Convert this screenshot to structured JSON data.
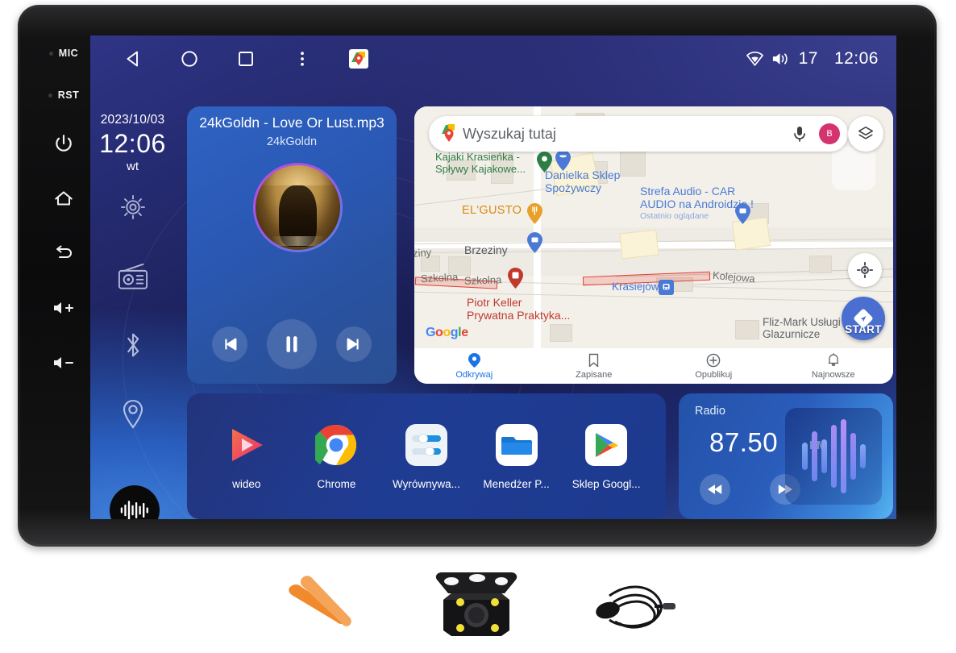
{
  "device": {
    "hardware_buttons": [
      {
        "name": "mic",
        "label": "MIC"
      },
      {
        "name": "rst",
        "label": "RST"
      },
      {
        "name": "power",
        "label": "power-icon"
      },
      {
        "name": "home",
        "label": "home-icon"
      },
      {
        "name": "back",
        "label": "back-icon"
      },
      {
        "name": "volume-up",
        "label": "vol-up-icon"
      },
      {
        "name": "volume-down",
        "label": "vol-down-icon"
      }
    ]
  },
  "statusbar": {
    "nav": [
      {
        "name": "back",
        "icon": "triangle-left-icon"
      },
      {
        "name": "home",
        "icon": "circle-icon"
      },
      {
        "name": "recents",
        "icon": "square-icon"
      },
      {
        "name": "more",
        "icon": "overflow-dots-icon"
      },
      {
        "name": "maps-shortcut",
        "icon": "google-maps-pin-icon"
      }
    ],
    "wifi_icon": "wifi-icon",
    "volume_icon": "speaker-icon",
    "volume_level": "17",
    "clock": "12:06"
  },
  "dock": {
    "date": "2023/10/03",
    "time": "12:06",
    "weekday": "wt",
    "items": [
      {
        "name": "settings",
        "icon": "gear-icon"
      },
      {
        "name": "radio",
        "icon": "radio-icon"
      },
      {
        "name": "bluetooth",
        "icon": "bluetooth-icon"
      },
      {
        "name": "navigation",
        "icon": "location-pin-icon"
      }
    ],
    "assistant": {
      "name": "voice-assistant",
      "icon": "waveform-icon"
    }
  },
  "music": {
    "title": "24kGoldn - Love Or Lust.mp3",
    "artist": "24kGoldn",
    "album_art_alt": "24kGoldn album cover",
    "controls": [
      {
        "name": "previous-track",
        "icon": "skip-previous-icon"
      },
      {
        "name": "play-pause",
        "icon": "pause-icon"
      },
      {
        "name": "next-track",
        "icon": "skip-next-icon"
      }
    ]
  },
  "maps": {
    "search_placeholder": "Wyszukaj tutaj",
    "mic_icon": "microphone-icon",
    "avatar_initial": "B",
    "layers_icon": "layers-icon",
    "locate_icon": "my-location-icon",
    "start_label": "START",
    "attribution": "Google",
    "pois": [
      {
        "name": "kajaki",
        "line1": "Kajaki Krasieńka -",
        "line2": "Spływy Kajakowe...",
        "color": "green"
      },
      {
        "name": "danielka",
        "line1": "Danielka Sklep",
        "line2": "Spożywczy",
        "color": "blue"
      },
      {
        "name": "strefa-audio",
        "line1": "Strefa Audio - CAR",
        "line2": "AUDIO na Androidzie !",
        "sub": "Ostatnio oglądane",
        "color": "blue"
      },
      {
        "name": "elgusto",
        "line1": "EL'GUSTO",
        "color": "orange"
      },
      {
        "name": "piotr-keller",
        "line1": "Piotr Keller",
        "line2": "Prywatna Praktyka...",
        "color": "red"
      },
      {
        "name": "fliz-mark",
        "line1": "Fliz-Mark Usługi",
        "line2": "Glazurnicze",
        "color": "grey"
      },
      {
        "name": "krasiejow-station",
        "line1": "Krasiejów",
        "color": "blue"
      }
    ],
    "streets": [
      "ziny",
      "Brzeziny",
      "Szkolna",
      "Szkolna",
      "Kolejowa"
    ],
    "bottom_nav": [
      {
        "name": "odkrywaj",
        "label": "Odkrywaj",
        "icon": "explore-pin-icon",
        "active": true
      },
      {
        "name": "zapisane",
        "label": "Zapisane",
        "icon": "bookmark-icon",
        "active": false
      },
      {
        "name": "opublikuj",
        "label": "Opublikuj",
        "icon": "plus-circle-icon",
        "active": false
      },
      {
        "name": "najnowsze",
        "label": "Najnowsze",
        "icon": "bell-icon",
        "active": false
      }
    ]
  },
  "apps": [
    {
      "name": "wideo",
      "label": "wideo",
      "icon": "video-player-icon"
    },
    {
      "name": "chrome",
      "label": "Chrome",
      "icon": "chrome-icon"
    },
    {
      "name": "wyrownywanie",
      "label": "Wyrównywa...",
      "icon": "equalizer-icon"
    },
    {
      "name": "menedzer-plikow",
      "label": "Menedżer P...",
      "icon": "folder-icon"
    },
    {
      "name": "sklep-google-play",
      "label": "Sklep Googl...",
      "icon": "google-play-icon"
    }
  ],
  "radio": {
    "title": "Radio",
    "frequency": "87.50",
    "band": "FM",
    "prev_icon": "rewind-icon",
    "next_icon": "fast-forward-icon",
    "visualizer_icon": "audio-bars-icon"
  },
  "accessories": [
    {
      "name": "pry-tools",
      "alt": "orange plastic pry tools"
    },
    {
      "name": "reverse-camera",
      "alt": "LED reverse camera"
    },
    {
      "name": "external-microphone",
      "alt": "external microphone with cable"
    }
  ],
  "colors": {
    "accent_blue": "#1a73e8",
    "screen_blue": "#1f3c93",
    "avatar_pink": "#d5336f",
    "start_blue": "#4a6fd0",
    "route_red": "#e0412f"
  }
}
